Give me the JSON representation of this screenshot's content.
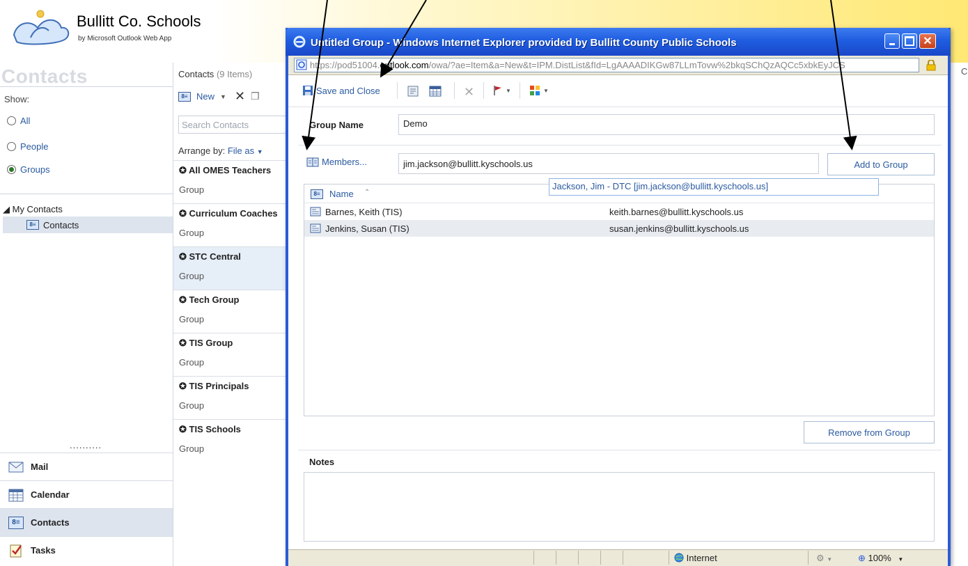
{
  "owa": {
    "brand": "Bullitt Co. Schools",
    "brand_sub": "by Microsoft Outlook Web App",
    "section_title": "Contacts",
    "show_label": "Show:",
    "filters": [
      "All",
      "People",
      "Groups"
    ],
    "selected_filter": "Groups",
    "tree_head": "◢ My Contacts",
    "tree_item": "Contacts",
    "dots": "..........",
    "bottom_nav": [
      "Mail",
      "Calendar",
      "Contacts",
      "Tasks"
    ],
    "active_nav": "Contacts",
    "list_header": "Contacts",
    "list_count": "(9 Items)",
    "new_label": "New",
    "search_placeholder": "Search Contacts",
    "arrange_label": "Arrange by:",
    "arrange_value": "File as",
    "groups": [
      {
        "name": "All OMES Teachers",
        "type": "Group"
      },
      {
        "name": "Curriculum Coaches",
        "type": "Group"
      },
      {
        "name": "STC Central",
        "type": "Group"
      },
      {
        "name": "Tech Group",
        "type": "Group"
      },
      {
        "name": "TIS Group",
        "type": "Group"
      },
      {
        "name": "TIS Principals",
        "type": "Group"
      },
      {
        "name": "TIS Schools",
        "type": "Group"
      }
    ],
    "selected_group": "STC Central"
  },
  "ie": {
    "title": "Untitled Group - Windows Internet Explorer provided by Bullitt County Public Schools",
    "url_prefix": "https://pod51004.",
    "url_domain": "outlook.com",
    "url_rest": "/owa/?ae=Item&a=New&t=IPM.DistList&fId=LgAAAADIKGw87LLmTovw%2bkqSChQzAQCc5xbkEyJCS",
    "stray": "C",
    "status_zone": "Internet",
    "zoom": "100%"
  },
  "form": {
    "save_close": "Save and Close",
    "group_name_label": "Group Name",
    "group_name_value": "Demo",
    "members_label": "Members...",
    "member_input_value": "jim.jackson@bullitt.kyschools.us",
    "add_button": "Add to Group",
    "suggestion": "Jackson, Jim - DTC [jim.jackson@bullitt.kyschools.us]",
    "column_name": "Name",
    "sort_glyph": "⌃",
    "members": [
      {
        "name": "Barnes, Keith (TIS)",
        "email": "keith.barnes@bullitt.kyschools.us"
      },
      {
        "name": "Jenkins, Susan (TIS)",
        "email": "susan.jenkins@bullitt.kyschools.us"
      }
    ],
    "remove_button": "Remove from Group",
    "notes_label": "Notes"
  },
  "colors": {
    "ie_title_blue": "#1f5de0",
    "link_blue": "#2a5aa0",
    "selected_bg": "#dde4ee",
    "header_yellow": "#ffe873"
  }
}
